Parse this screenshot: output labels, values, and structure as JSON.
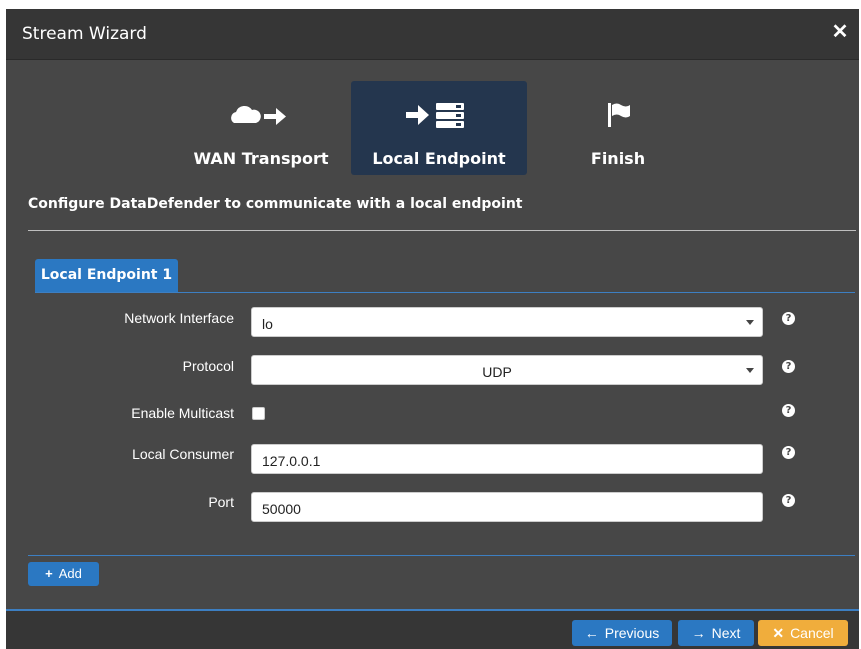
{
  "window": {
    "title": "Stream Wizard",
    "close_glyph": "✕"
  },
  "steps": [
    {
      "label": "WAN Transport",
      "icons": [
        "cloud-icon",
        "arrow-right-icon"
      ]
    },
    {
      "label": "Local Endpoint",
      "icons": [
        "arrow-right-icon",
        "server-icon"
      ],
      "active": true
    },
    {
      "label": "Finish",
      "icons": [
        "flag-icon"
      ]
    }
  ],
  "subtitle": "Configure DataDefender to communicate with a local endpoint",
  "tab": {
    "label": "Local Endpoint 1"
  },
  "form": {
    "network_interface": {
      "label": "Network Interface",
      "value": "lo"
    },
    "protocol": {
      "label": "Protocol",
      "value": "UDP"
    },
    "multicast": {
      "label": "Enable Multicast",
      "checked": false
    },
    "local_consumer": {
      "label": "Local Consumer",
      "value": "127.0.0.1"
    },
    "port": {
      "label": "Port",
      "value": "50000"
    }
  },
  "add_button": {
    "icon": "+",
    "label": "Add"
  },
  "footer": {
    "previous": {
      "icon": "←",
      "label": "Previous"
    },
    "next": {
      "icon": "→",
      "label": "Next"
    },
    "cancel": {
      "icon": "✕",
      "label": "Cancel"
    }
  },
  "colors": {
    "accent": "#2b78c2",
    "warning": "#f0ad3c",
    "active_step": "#24364e",
    "panel": "#474747",
    "titlebar": "#363636"
  }
}
